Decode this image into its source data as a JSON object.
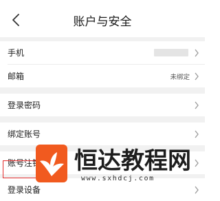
{
  "header": {
    "title": "账户与安全",
    "back_icon": "chevron-left-icon"
  },
  "settings": {
    "items": [
      {
        "label": "手机",
        "value": ""
      },
      {
        "label": "邮箱",
        "value": "未绑定"
      },
      {
        "label": "登录密码",
        "value": ""
      },
      {
        "label": "绑定账号",
        "value": ""
      },
      {
        "label": "账号注销",
        "value": ""
      },
      {
        "label": "登录设备",
        "value": ""
      }
    ]
  },
  "watermark": {
    "brand": "恒达教程网",
    "url": "www.sxhdcj.com",
    "logo_icon": "whale-tail-logo-icon"
  },
  "colors": {
    "highlight": "#e32b2b",
    "logo": "#f15a1f",
    "divider": "#f1f1f1"
  }
}
